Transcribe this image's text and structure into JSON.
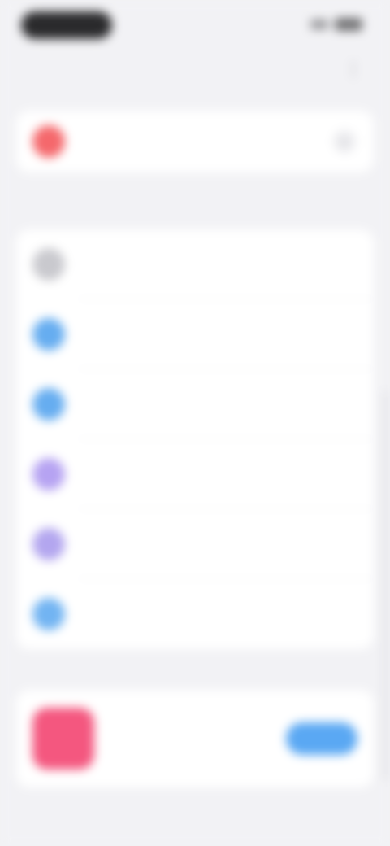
{
  "status_bar": {
    "time": "",
    "signal_icon": "signal-icon",
    "battery_icon": "battery-icon"
  },
  "nav": {
    "title": "",
    "action_icon": "more-icon"
  },
  "top_card": {
    "label": "",
    "icon": "red-circle-icon",
    "icon_color": "#f5686c",
    "chevron": "›"
  },
  "caption": "",
  "list": {
    "items": [
      {
        "label": "",
        "icon": "gray-circle-icon",
        "color": "#c9c9ce"
      },
      {
        "label": "",
        "icon": "blue-circle-icon",
        "color": "#66adf0"
      },
      {
        "label": "",
        "icon": "blue-circle-icon",
        "color": "#66adf0"
      },
      {
        "label": "",
        "icon": "purple-circle-icon",
        "color": "#b6a3f2"
      },
      {
        "label": "",
        "icon": "purple-circle-icon",
        "color": "#b3a6ef"
      },
      {
        "label": "",
        "icon": "blue-circle-icon",
        "color": "#72b4f2"
      }
    ]
  },
  "promo": {
    "title": "",
    "subtitle": "",
    "button_label": "",
    "art_color": "#f4577f",
    "button_color": "#5aa8f3"
  }
}
